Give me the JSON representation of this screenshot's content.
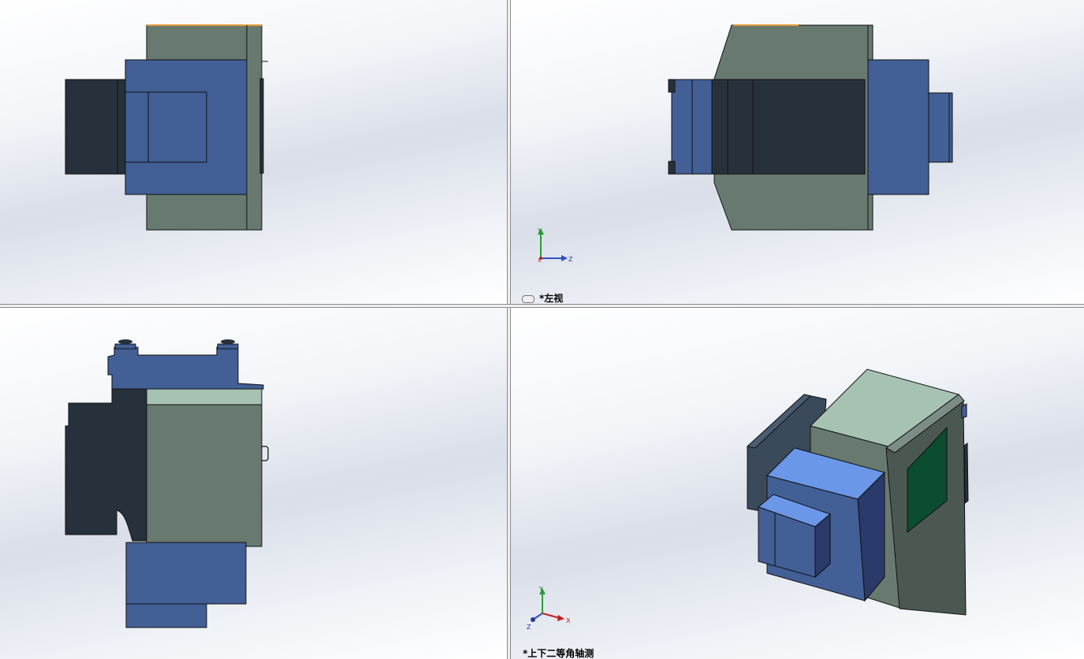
{
  "viewports": {
    "top_left": {
      "label": ""
    },
    "top_right": {
      "label": "*左视"
    },
    "bottom_left": {
      "label": ""
    },
    "bottom_right": {
      "label": "*上下二等角轴测"
    }
  },
  "triad": {
    "x": "X",
    "y": "Y",
    "z": "Z"
  },
  "colors": {
    "blue": "#425f96",
    "dark": "#27313b",
    "green_gray": "#687a70",
    "light_green": "#a6c2b3",
    "light_blue": "#6a97e8",
    "deep_green": "#0c4c31",
    "accent_orange": "#e09a3a"
  }
}
